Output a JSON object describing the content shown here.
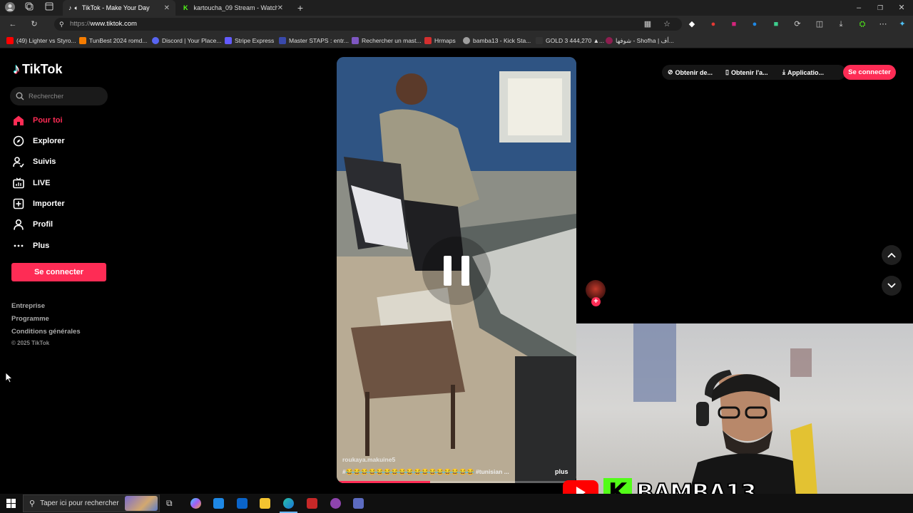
{
  "browser": {
    "tabs": [
      {
        "title": "TikTok - Make Your Day",
        "active": true
      },
      {
        "title": "kartoucha_09 Stream - Watch Li…",
        "active": false
      }
    ],
    "url_prefix": "https://",
    "url_host": "www.tiktok.com",
    "bookmarks": [
      "(49) Lighter vs Styro...",
      "TunBest 2024 romd...",
      "Discord | Your Place...",
      "Stripe Express",
      "Master STAPS : entr...",
      "Rechercher un mast...",
      "Hrmaps",
      "bamba13 - Kick Sta...",
      "GOLD 3 444,270 ▲...",
      "شوفها - Shofha | أف..."
    ]
  },
  "tiktok": {
    "logo": "TikTok",
    "search_placeholder": "Rechercher",
    "nav": [
      {
        "label": "Pour toi",
        "icon": "home-icon"
      },
      {
        "label": "Explorer",
        "icon": "compass-icon"
      },
      {
        "label": "Suivis",
        "icon": "following-icon"
      },
      {
        "label": "LIVE",
        "icon": "live-icon"
      },
      {
        "label": "Importer",
        "icon": "upload-icon"
      },
      {
        "label": "Profil",
        "icon": "profile-icon"
      },
      {
        "label": "Plus",
        "icon": "more-icon"
      }
    ],
    "login_button": "Se connecter",
    "footer": [
      "Entreprise",
      "Programme",
      "Conditions générales",
      "© 2025 TikTok"
    ],
    "header": {
      "get_coins": "Obtenir de...",
      "get_app": "Obtenir l'a...",
      "applications": "Applicatio...",
      "login": "Se connecter"
    },
    "video": {
      "author": "roukaya.makuine5",
      "caption": "#😂😂😂😂😂😂😂😂😂😂😂😂😂😂😂😂😂 #tunisian ...",
      "more": "plus",
      "progress": 0.39
    }
  },
  "overlay": {
    "streamer_name": "BAMBA13"
  },
  "taskbar": {
    "search_placeholder": "Taper ici pour rechercher"
  },
  "colors": {
    "accent": "#fe2c55",
    "kick": "#53fc18",
    "youtube": "#ff0000"
  }
}
